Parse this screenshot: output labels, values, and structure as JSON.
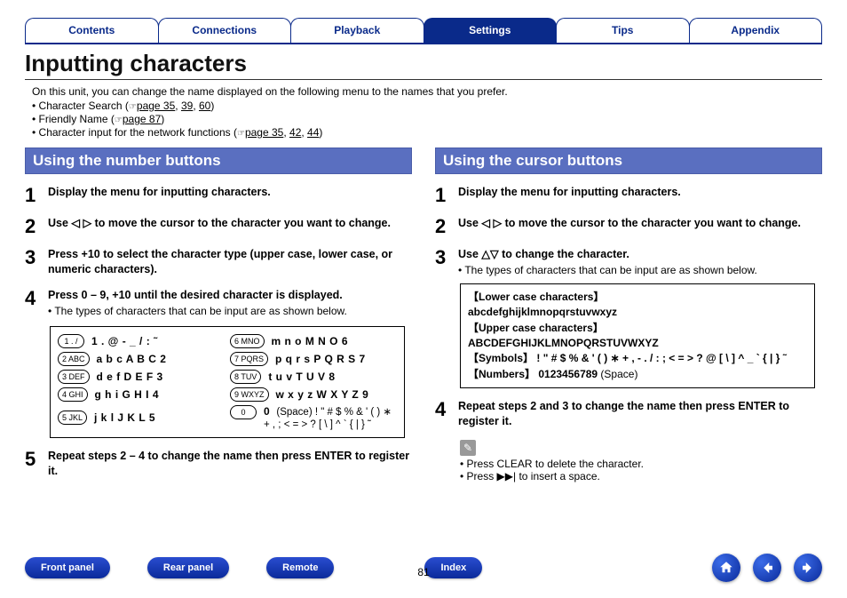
{
  "tabs": [
    "Contents",
    "Connections",
    "Playback",
    "Settings",
    "Tips",
    "Appendix"
  ],
  "active_tab_index": 3,
  "title": "Inputting characters",
  "intro": "On this unit, you can change the name displayed on the following menu to the names that you prefer.",
  "intro_bullets": [
    {
      "prefix": "• Character Search (",
      "links": [
        "page 35",
        "39",
        "60"
      ],
      "suffix": ")"
    },
    {
      "prefix": "• Friendly Name (",
      "links": [
        "page 87"
      ],
      "suffix": ")"
    },
    {
      "prefix": "• Character input for the network functions (",
      "links": [
        "page 35",
        "42",
        "44"
      ],
      "suffix": ")"
    }
  ],
  "left": {
    "heading": "Using the number buttons",
    "steps": [
      {
        "n": "1",
        "title": "Display the menu for inputting characters."
      },
      {
        "n": "2",
        "title": "Use ◁ ▷ to move the cursor to the character you want to change."
      },
      {
        "n": "3",
        "title": "Press +10 to select the character type (upper case, lower case, or numeric characters)."
      },
      {
        "n": "4",
        "title": "Press 0 – 9, +10 until the desired character is displayed.",
        "note": "The types of characters that can be input are as shown below."
      },
      {
        "n": "5",
        "title": "Repeat steps 2 – 4 to change the name then press ENTER to register it."
      }
    ],
    "key_rows": [
      {
        "k1": "1 . /",
        "c1": "1 . @ - _ / : ˜",
        "k2": "6 MNO",
        "c2": "m n o M N O 6"
      },
      {
        "k1": "2 ABC",
        "c1": "a b c A B C 2",
        "k2": "7 PQRS",
        "c2": "p q r s P Q R S 7"
      },
      {
        "k1": "3 DEF",
        "c1": "d e f D E F 3",
        "k2": "8 TUV",
        "c2": "t u v T U V 8"
      },
      {
        "k1": "4 GHI",
        "c1": "g h i G H I 4",
        "k2": "9 WXYZ",
        "c2": "w x y z W X Y Z 9"
      },
      {
        "k1": "5 JKL",
        "c1": "j k l J K L 5",
        "k2": "0",
        "c2": "0",
        "c2_after": " (Space) ! \" # $ % & ' ( ) ∗ + , ; < = > ? [ \\ ] ^ ` { | } ˜"
      }
    ]
  },
  "right": {
    "heading": "Using the cursor buttons",
    "steps": [
      {
        "n": "1",
        "title": "Display the menu for inputting characters."
      },
      {
        "n": "2",
        "title": "Use ◁ ▷ to move the cursor to the character you want to change."
      },
      {
        "n": "3",
        "title": "Use △▽ to change the character.",
        "note": "The types of characters that can be input are as shown below."
      },
      {
        "n": "4",
        "title": "Repeat steps 2 and 3 to change the name then press ENTER to register it."
      }
    ],
    "box": {
      "l1_lbl": "【Lower case characters】",
      "l1_val": "abcdefghijklmnopqrstuvwxyz",
      "l2_lbl": "【Upper case characters】",
      "l2_val": "ABCDEFGHIJKLMNOPQRSTUVWXYZ",
      "l3_lbl": "【Symbols】",
      "l3_val": " ! \" # $ % & ' ( ) ∗ + , - . / : ; < = > ? @ [ \\ ] ^ _ ` { | } ˜",
      "l4_lbl": "【Numbers】",
      "l4_val": " 0123456789",
      "l4_suffix": " (Space)"
    },
    "tips": [
      "Press CLEAR to delete the character.",
      "Press ▶▶| to insert a space."
    ]
  },
  "footer": {
    "buttons": [
      "Front panel",
      "Rear panel",
      "Remote"
    ],
    "index": "Index",
    "page": "81"
  }
}
